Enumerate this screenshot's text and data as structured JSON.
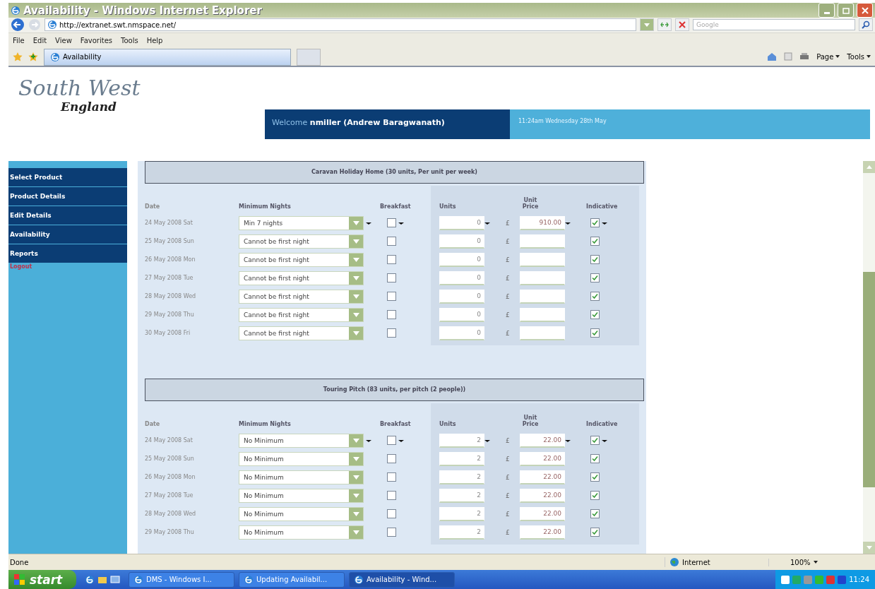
{
  "window": {
    "title": "Availability - Windows Internet Explorer"
  },
  "address_bar": {
    "url": "http://extranet.swt.nmspace.net/",
    "search_placeholder": "Google"
  },
  "menu_bar": [
    "File",
    "Edit",
    "View",
    "Favorites",
    "Tools",
    "Help"
  ],
  "tabs": [
    {
      "label": "Availability",
      "selected": true
    }
  ],
  "command_bar": [
    "Page",
    "Tools"
  ],
  "site": {
    "logo_line_1": "South West",
    "logo_line_2": "England",
    "welcome": "Welcome **nmiller (Andrew Baragwanath)**",
    "datetime": "11:24am Wednesday 28th May"
  },
  "sidebar": {
    "items": [
      "Select Product",
      "Product Details",
      "Edit Details",
      "Availability",
      "Reports"
    ],
    "logout": "Logout"
  },
  "sections": [
    {
      "title": "Caravan Holiday Home (30 units, Per unit per week)",
      "columns": {
        "date": "Date",
        "minimum_nights": "Minimum Nights",
        "breakfast": "Breakfast",
        "units": "Units",
        "unit_price": "Unit Price",
        "indicative": "Indicative"
      },
      "rows": [
        {
          "date": "24 May 2008 Sat",
          "minimum_nights": "Min 7 nights",
          "breakfast": false,
          "units": "0",
          "currency": "£",
          "unit_price": "910.00",
          "indicative": true,
          "copy_down": true
        },
        {
          "date": "25 May 2008 Sun",
          "minimum_nights": "Cannot be first night",
          "breakfast": false,
          "units": "0",
          "currency": "£",
          "indicative": true,
          "copy_down": false
        },
        {
          "date": "26 May 2008 Mon",
          "minimum_nights": "Cannot be first night",
          "breakfast": false,
          "units": "0",
          "currency": "£",
          "indicative": true,
          "copy_down": false
        },
        {
          "date": "27 May 2008 Tue",
          "minimum_nights": "Cannot be first night",
          "breakfast": false,
          "units": "0",
          "currency": "£",
          "indicative": true,
          "copy_down": false
        },
        {
          "date": "28 May 2008 Wed",
          "minimum_nights": "Cannot be first night",
          "breakfast": false,
          "units": "0",
          "currency": "£",
          "indicative": true,
          "copy_down": false
        },
        {
          "date": "29 May 2008 Thu",
          "minimum_nights": "Cannot be first night",
          "breakfast": false,
          "units": "0",
          "currency": "£",
          "indicative": true,
          "copy_down": false
        },
        {
          "date": "30 May 2008 Fri",
          "minimum_nights": "Cannot be first night",
          "breakfast": false,
          "units": "0",
          "currency": "£",
          "indicative": true,
          "copy_down": false
        }
      ]
    },
    {
      "title": "Touring Pitch (83 units, per pitch (2 people))",
      "columns": {
        "date": "Date",
        "minimum_nights": "Minimum Nights",
        "breakfast": "Breakfast",
        "units": "Units",
        "unit_price": "Unit Price",
        "indicative": "Indicative"
      },
      "rows": [
        {
          "date": "24 May 2008 Sat",
          "minimum_nights": "No Minimum",
          "breakfast": false,
          "units": "2",
          "currency": "£",
          "unit_price": "22.00",
          "indicative": true,
          "copy_down": true
        },
        {
          "date": "25 May 2008 Sun",
          "minimum_nights": "No Minimum",
          "breakfast": false,
          "units": "2",
          "currency": "£",
          "unit_price": "22.00",
          "indicative": true,
          "copy_down": false
        },
        {
          "date": "26 May 2008 Mon",
          "minimum_nights": "No Minimum",
          "breakfast": false,
          "units": "2",
          "currency": "£",
          "unit_price": "22.00",
          "indicative": true,
          "copy_down": false
        },
        {
          "date": "27 May 2008 Tue",
          "minimum_nights": "No Minimum",
          "breakfast": false,
          "units": "2",
          "currency": "£",
          "unit_price": "22.00",
          "indicative": true,
          "copy_down": false
        },
        {
          "date": "28 May 2008 Wed",
          "minimum_nights": "No Minimum",
          "breakfast": false,
          "units": "2",
          "currency": "£",
          "unit_price": "22.00",
          "indicative": true,
          "copy_down": false
        },
        {
          "date": "29 May 2008 Thu",
          "minimum_nights": "No Minimum",
          "breakfast": false,
          "units": "2",
          "currency": "£",
          "unit_price": "22.00",
          "indicative": true,
          "copy_down": false
        }
      ]
    }
  ],
  "status_bar": {
    "text": "Done",
    "zone": "Internet",
    "zoom": "100%"
  },
  "taskbar": {
    "start": "start",
    "buttons": [
      {
        "label": "DMS - Windows I...",
        "selected": false
      },
      {
        "label": "Updating Availabil...",
        "selected": false
      },
      {
        "label": "Availability - Wind...",
        "selected": true
      }
    ],
    "clock": "11:24"
  }
}
